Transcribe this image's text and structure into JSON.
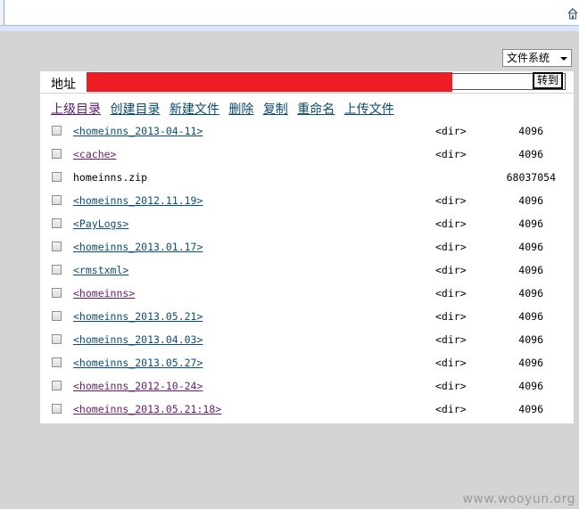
{
  "filesystem_select": "文件系统",
  "address": {
    "label": "地址",
    "go_label": "转到"
  },
  "actions": [
    "上级目录",
    "创建目录",
    "新建文件",
    "删除",
    "复制",
    "重命名",
    "上传文件"
  ],
  "files": [
    {
      "name": "<homeinns_2013-04-11>",
      "type": "<dir>",
      "size": "4096",
      "style": "unvisited"
    },
    {
      "name": "<cache>",
      "type": "<dir>",
      "size": "4096",
      "style": "visited"
    },
    {
      "name": "homeinns.zip",
      "type": "",
      "size": "68037054",
      "style": "plain"
    },
    {
      "name": "<homeinns_2012.11.19>",
      "type": "<dir>",
      "size": "4096",
      "style": "unvisited"
    },
    {
      "name": "<PayLogs>",
      "type": "<dir>",
      "size": "4096",
      "style": "unvisited"
    },
    {
      "name": "<homeinns_2013.01.17>",
      "type": "<dir>",
      "size": "4096",
      "style": "unvisited"
    },
    {
      "name": "<rmstxml>",
      "type": "<dir>",
      "size": "4096",
      "style": "unvisited"
    },
    {
      "name": "<homeinns>",
      "type": "<dir>",
      "size": "4096",
      "style": "visited"
    },
    {
      "name": "<homeinns_2013.05.21>",
      "type": "<dir>",
      "size": "4096",
      "style": "unvisited"
    },
    {
      "name": "<homeinns_2013.04.03>",
      "type": "<dir>",
      "size": "4096",
      "style": "unvisited"
    },
    {
      "name": "<homeinns_2013.05.27>",
      "type": "<dir>",
      "size": "4096",
      "style": "unvisited"
    },
    {
      "name": "<homeinns_2012-10-24>",
      "type": "<dir>",
      "size": "4096",
      "style": "visited"
    },
    {
      "name": "<homeinns_2013.05.21:18>",
      "type": "<dir>",
      "size": "4096",
      "style": "visited"
    }
  ],
  "watermark": "www.wooyun.org",
  "colors": {
    "redaction": "#ee1c25",
    "link": "#0a4d78",
    "visited_link": "#6a1b6f"
  }
}
